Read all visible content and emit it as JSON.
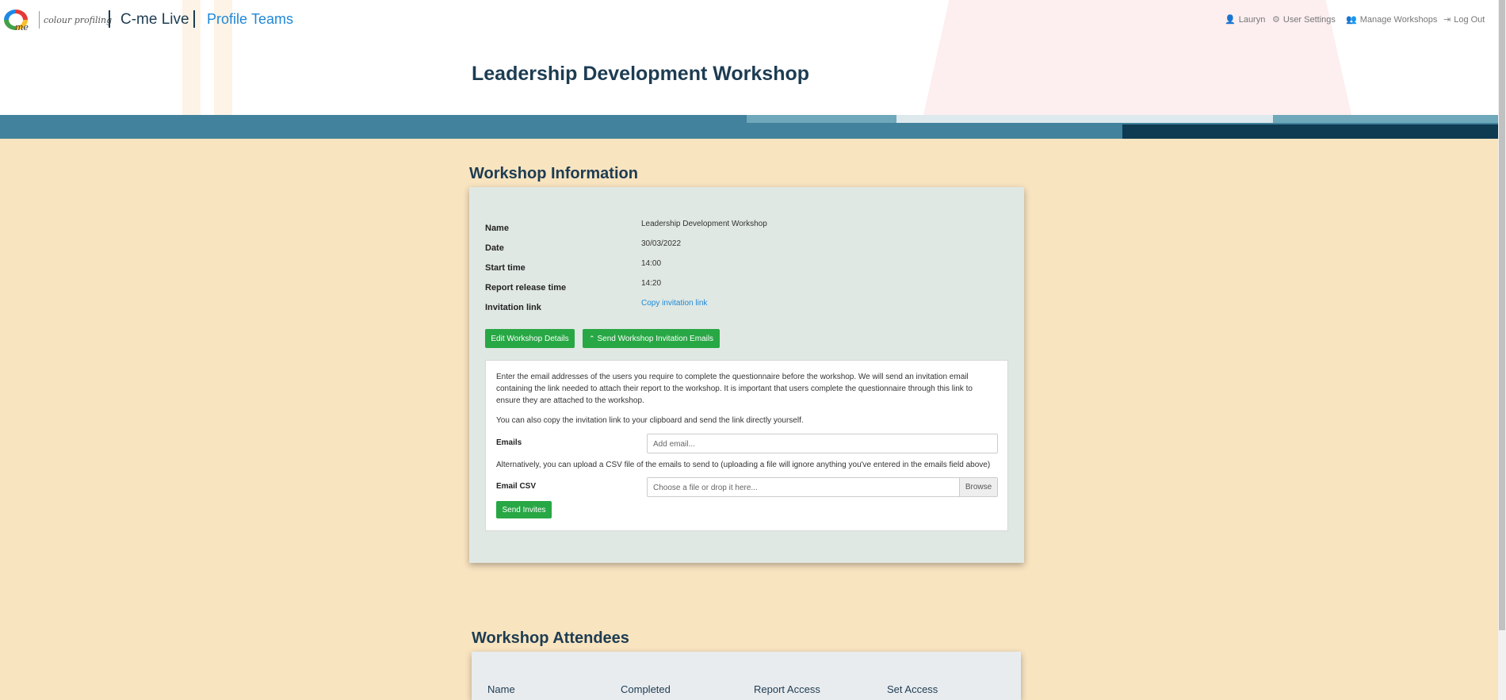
{
  "header": {
    "logo_me": "me",
    "logo_text": "colour profiling",
    "brand": "C-me Live",
    "nav": [
      {
        "label": "Profile"
      },
      {
        "label": "Teams"
      }
    ],
    "user_links": [
      {
        "icon": "user-icon",
        "glyph": "👤",
        "label": "Lauryn"
      },
      {
        "icon": "user-settings-icon",
        "glyph": "⚙",
        "label": "User Settings"
      },
      {
        "icon": "users-icon",
        "glyph": "👥",
        "label": "Manage Workshops"
      },
      {
        "icon": "logout-icon",
        "glyph": "⇥",
        "label": "Log Out"
      }
    ],
    "page_title": "Leadership Development Workshop"
  },
  "workshop_info": {
    "title": "Workshop Information",
    "rows": [
      {
        "label": "Name",
        "value": "Leadership Development Workshop"
      },
      {
        "label": "Date",
        "value": "30/03/2022"
      },
      {
        "label": "Start time",
        "value": "14:00"
      },
      {
        "label": "Report release time",
        "value": "14:20"
      },
      {
        "label": "Invitation link",
        "value": "Copy invitation link"
      }
    ],
    "edit_button": "Edit Workshop Details",
    "send_emails_button": "Send Workshop Invitation Emails",
    "send_emails_icon": "⌃",
    "panel": {
      "para1": "Enter the email addresses of the users you require to complete the questionnaire before the workshop. We will send an invitation email containing the link needed to attach their report to the workshop. It is important that users complete the questionnaire through this link to ensure they are attached to the workshop.",
      "para2": "You can also copy the invitation link to your clipboard and send the link directly yourself.",
      "emails_label": "Emails",
      "emails_placeholder": "Add email...",
      "csv_note": "Alternatively, you can upload a CSV file of the emails to send to (uploading a file will ignore anything you've entered in the emails field above)",
      "csv_label": "Email CSV",
      "csv_placeholder": "Choose a file or drop it here...",
      "browse": "Browse",
      "send_invites": "Send Invites"
    }
  },
  "attendees": {
    "title": "Workshop Attendees",
    "columns": [
      "Name",
      "Completed",
      "Report Access",
      "Set Access"
    ]
  },
  "colors": {
    "navy": "#1d3c52",
    "teal": "#42829c",
    "green": "#28a745",
    "link": "#1e88d8",
    "background": "#f9e4c0"
  }
}
